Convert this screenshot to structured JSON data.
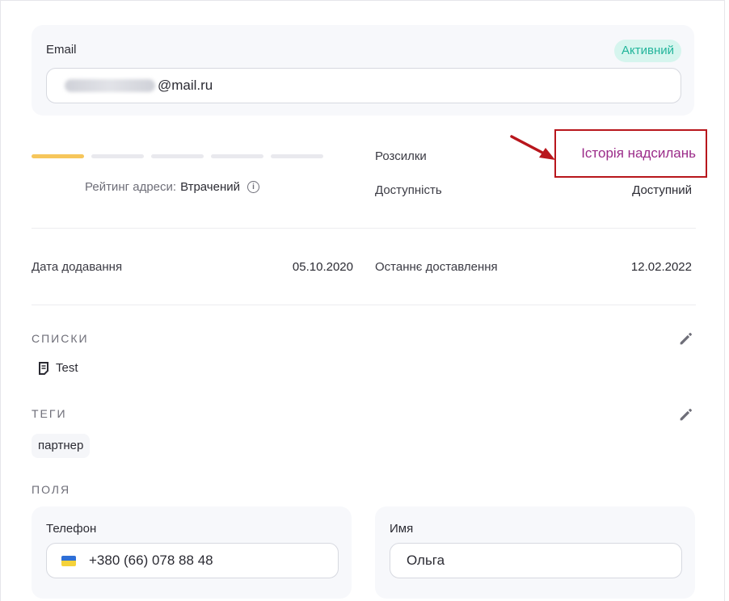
{
  "email": {
    "label": "Email",
    "status": "Активний",
    "domain_part": "@mail.ru"
  },
  "rating": {
    "label": "Рейтинг адреси:",
    "value": "Втрачений",
    "filled": 1,
    "total": 5
  },
  "mailings": {
    "label": "Розсилки",
    "link": "Історія надсилань"
  },
  "availability": {
    "label": "Доступність",
    "value": "Доступний"
  },
  "dates": {
    "added_label": "Дата додавання",
    "added_value": "05.10.2020",
    "delivered_label": "Останнє доставлення",
    "delivered_value": "12.02.2022"
  },
  "lists": {
    "title": "СПИСКИ",
    "items": [
      "Test"
    ]
  },
  "tags": {
    "title": "ТЕГИ",
    "items": [
      "партнер"
    ]
  },
  "fields": {
    "title": "ПОЛЯ",
    "phone_label": "Телефон",
    "phone_value": "+380 (66) 078 88 48",
    "name_label": "Имя",
    "name_value": "Ольга"
  },
  "colors": {
    "accent_link": "#9b2c89",
    "status_green": "#22b59b",
    "rating_filled": "#f6c65b",
    "highlight_red": "#b8161c"
  },
  "icons": {
    "edit": "pencil-icon",
    "info": "info-icon",
    "list": "document-icon",
    "flag": "ukraine-flag-icon"
  }
}
